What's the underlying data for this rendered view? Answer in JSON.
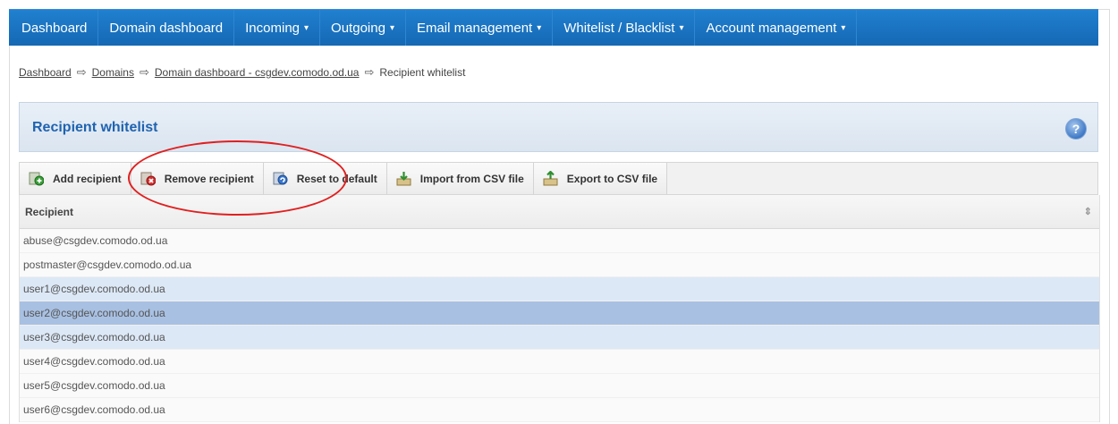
{
  "nav": {
    "items": [
      {
        "label": "Dashboard",
        "dropdown": false
      },
      {
        "label": "Domain dashboard",
        "dropdown": false
      },
      {
        "label": "Incoming",
        "dropdown": true
      },
      {
        "label": "Outgoing",
        "dropdown": true
      },
      {
        "label": "Email management",
        "dropdown": true
      },
      {
        "label": "Whitelist / Blacklist",
        "dropdown": true
      },
      {
        "label": "Account management",
        "dropdown": true
      }
    ],
    "caret": "▾"
  },
  "breadcrumb": {
    "items": [
      "Dashboard",
      "Domains",
      "Domain dashboard - csgdev.comodo.od.ua",
      "Recipient whitelist"
    ],
    "separator": "⇨"
  },
  "panel": {
    "title": "Recipient whitelist",
    "help_symbol": "?"
  },
  "toolbar": {
    "buttons": [
      {
        "label": "Add recipient",
        "icon": "add-recipient-icon"
      },
      {
        "label": "Remove recipient",
        "icon": "remove-recipient-icon"
      },
      {
        "label": "Reset to default",
        "icon": "reset-icon"
      },
      {
        "label": "Import from CSV file",
        "icon": "import-csv-icon"
      },
      {
        "label": "Export to CSV file",
        "icon": "export-csv-icon"
      }
    ]
  },
  "table": {
    "header": "Recipient",
    "sort_symbol": "⇕",
    "rows": [
      {
        "email": "abuse@csgdev.comodo.od.ua",
        "state": "plain"
      },
      {
        "email": "postmaster@csgdev.comodo.od.ua",
        "state": "plain"
      },
      {
        "email": "user1@csgdev.comodo.od.ua",
        "state": "light"
      },
      {
        "email": "user2@csgdev.comodo.od.ua",
        "state": "selected"
      },
      {
        "email": "user3@csgdev.comodo.od.ua",
        "state": "light"
      },
      {
        "email": "user4@csgdev.comodo.od.ua",
        "state": "plain"
      },
      {
        "email": "user5@csgdev.comodo.od.ua",
        "state": "plain"
      },
      {
        "email": "user6@csgdev.comodo.od.ua",
        "state": "plain"
      }
    ]
  },
  "colors": {
    "nav_bg": "#1a73c2",
    "title": "#1f63b0",
    "row_light": "#dce8f6",
    "row_selected": "#a8c0e2",
    "annotation": "#e02020"
  }
}
